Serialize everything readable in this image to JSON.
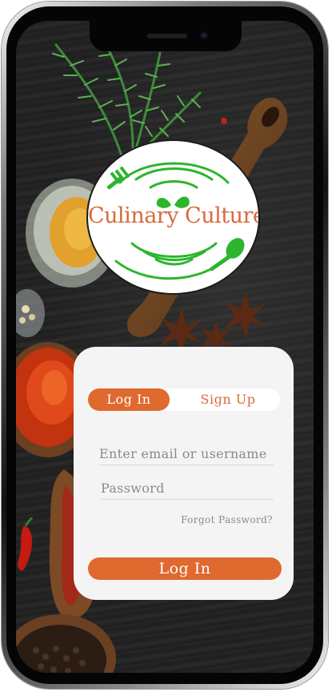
{
  "brand": {
    "name": "Culinary Culture",
    "accent_color": "#e0692f",
    "logo_green": "#2db52d"
  },
  "auth": {
    "tabs": [
      {
        "label": "Log In",
        "active": true
      },
      {
        "label": "Sign Up",
        "active": false
      }
    ],
    "email_placeholder": "Enter email or username",
    "password_placeholder": "Password",
    "forgot_label": "Forgot Password?",
    "submit_label": "Log In"
  }
}
